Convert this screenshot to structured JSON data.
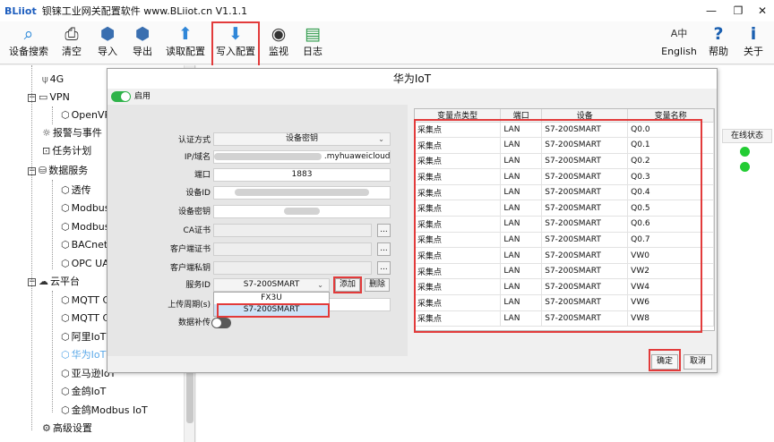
{
  "window": {
    "brand": "BLiiot",
    "title": "钡铼工业网关配置软件 www.BLiiot.cn V1.1.1",
    "minimize": "—",
    "restore": "❐",
    "close": "✕"
  },
  "toolbar": {
    "left": [
      {
        "label": "设备搜索",
        "icon": "search-icon",
        "glyph": "⌕"
      },
      {
        "label": "清空",
        "icon": "printer-icon",
        "glyph": "⎙"
      },
      {
        "label": "导入",
        "icon": "cube-in-icon",
        "glyph": "⬢"
      },
      {
        "label": "导出",
        "icon": "cube-out-icon",
        "glyph": "⬢"
      },
      {
        "label": "读取配置",
        "icon": "upload-arrow-icon",
        "glyph": "⬆"
      },
      {
        "label": "写入配置",
        "icon": "download-arrow-icon",
        "glyph": "⬇"
      },
      {
        "label": "监视",
        "icon": "eye-icon",
        "glyph": "◉"
      },
      {
        "label": "日志",
        "icon": "document-icon",
        "glyph": "▤"
      }
    ],
    "right": [
      {
        "label": "English",
        "icon": "language-icon",
        "glyph": "A中"
      },
      {
        "label": "帮助",
        "icon": "help-icon",
        "glyph": "?"
      },
      {
        "label": "关于",
        "icon": "info-icon",
        "glyph": "i"
      }
    ]
  },
  "tree": {
    "items": [
      {
        "label": "4G",
        "icon": "antenna-icon",
        "glyph": "⍦"
      },
      {
        "label": "VPN",
        "icon": "vpn-icon",
        "glyph": "▭",
        "box": "−"
      },
      {
        "label": "OpenVP",
        "icon": "cube-icon",
        "glyph": "⬡"
      },
      {
        "label": "报警与事件",
        "icon": "alarm-icon",
        "glyph": "☼"
      },
      {
        "label": "任务计划",
        "icon": "task-icon",
        "glyph": "⊡"
      },
      {
        "label": "数据服务",
        "icon": "database-icon",
        "glyph": "⛁",
        "box": "−"
      },
      {
        "label": "透传",
        "icon": "cube-icon",
        "glyph": "⬡"
      },
      {
        "label": "Modbus",
        "icon": "cube-icon",
        "glyph": "⬡"
      },
      {
        "label": "Modbus",
        "icon": "cube-icon",
        "glyph": "⬡"
      },
      {
        "label": "BACnet/",
        "icon": "cube-icon",
        "glyph": "⬡"
      },
      {
        "label": "OPC UA",
        "icon": "cube-icon",
        "glyph": "⬡"
      },
      {
        "label": "云平台",
        "icon": "cloud-icon",
        "glyph": "☁",
        "box": "−"
      },
      {
        "label": "MQTT C",
        "icon": "cube-icon",
        "glyph": "⬡"
      },
      {
        "label": "MQTT C",
        "icon": "cube-icon",
        "glyph": "⬡"
      },
      {
        "label": "阿里IoT",
        "icon": "cube-icon",
        "glyph": "⬡"
      },
      {
        "label": "华为IoT",
        "icon": "cube-icon",
        "glyph": "⬡"
      },
      {
        "label": "亚马逊IoT",
        "icon": "cube-icon",
        "glyph": "⬡"
      },
      {
        "label": "金鸽IoT",
        "icon": "cube-icon",
        "glyph": "⬡"
      },
      {
        "label": "金鸽Modbus IoT",
        "icon": "cube-icon",
        "glyph": "⬡"
      },
      {
        "label": "高级设置",
        "icon": "gear-icon",
        "glyph": "⚙"
      }
    ]
  },
  "background": {
    "status_header": "在线状态",
    "status_color": "#22cc33"
  },
  "dialog": {
    "title": "华为IoT",
    "enable_label": "启用",
    "enable_on": true,
    "accent": "#2fb34a",
    "form": {
      "auth_label": "认证方式",
      "auth_value": "设备密钥",
      "host_label": "IP/域名",
      "host_value": ".myhuaweicloud.",
      "port_label": "端口",
      "port_value": "1883",
      "device_id_label": "设备ID",
      "device_secret_label": "设备密钥",
      "ca_label": "CA证书",
      "client_cert_label": "客户端证书",
      "client_key_label": "客户端私钥",
      "browse": "...",
      "service_id_label": "服务ID",
      "service_id_value": "S7-200SMART",
      "add_button": "添加",
      "delete_button": "删除",
      "upload_period_label": "上传周期(s)",
      "data_resend_label": "数据补传"
    },
    "dropdown_options": [
      "FX3U",
      "S7-200SMART"
    ],
    "table": {
      "headers": [
        "变量点类型",
        "端口",
        "设备",
        "变量名称"
      ],
      "rows": [
        [
          "采集点",
          "LAN",
          "S7-200SMART",
          "Q0.0"
        ],
        [
          "采集点",
          "LAN",
          "S7-200SMART",
          "Q0.1"
        ],
        [
          "采集点",
          "LAN",
          "S7-200SMART",
          "Q0.2"
        ],
        [
          "采集点",
          "LAN",
          "S7-200SMART",
          "Q0.3"
        ],
        [
          "采集点",
          "LAN",
          "S7-200SMART",
          "Q0.4"
        ],
        [
          "采集点",
          "LAN",
          "S7-200SMART",
          "Q0.5"
        ],
        [
          "采集点",
          "LAN",
          "S7-200SMART",
          "Q0.6"
        ],
        [
          "采集点",
          "LAN",
          "S7-200SMART",
          "Q0.7"
        ],
        [
          "采集点",
          "LAN",
          "S7-200SMART",
          "VW0"
        ],
        [
          "采集点",
          "LAN",
          "S7-200SMART",
          "VW2"
        ],
        [
          "采集点",
          "LAN",
          "S7-200SMART",
          "VW4"
        ],
        [
          "采集点",
          "LAN",
          "S7-200SMART",
          "VW6"
        ],
        [
          "采集点",
          "LAN",
          "S7-200SMART",
          "VW8"
        ]
      ]
    },
    "ok_button": "确定",
    "cancel_button": "取消"
  },
  "highlight_color": "#e23b3b"
}
